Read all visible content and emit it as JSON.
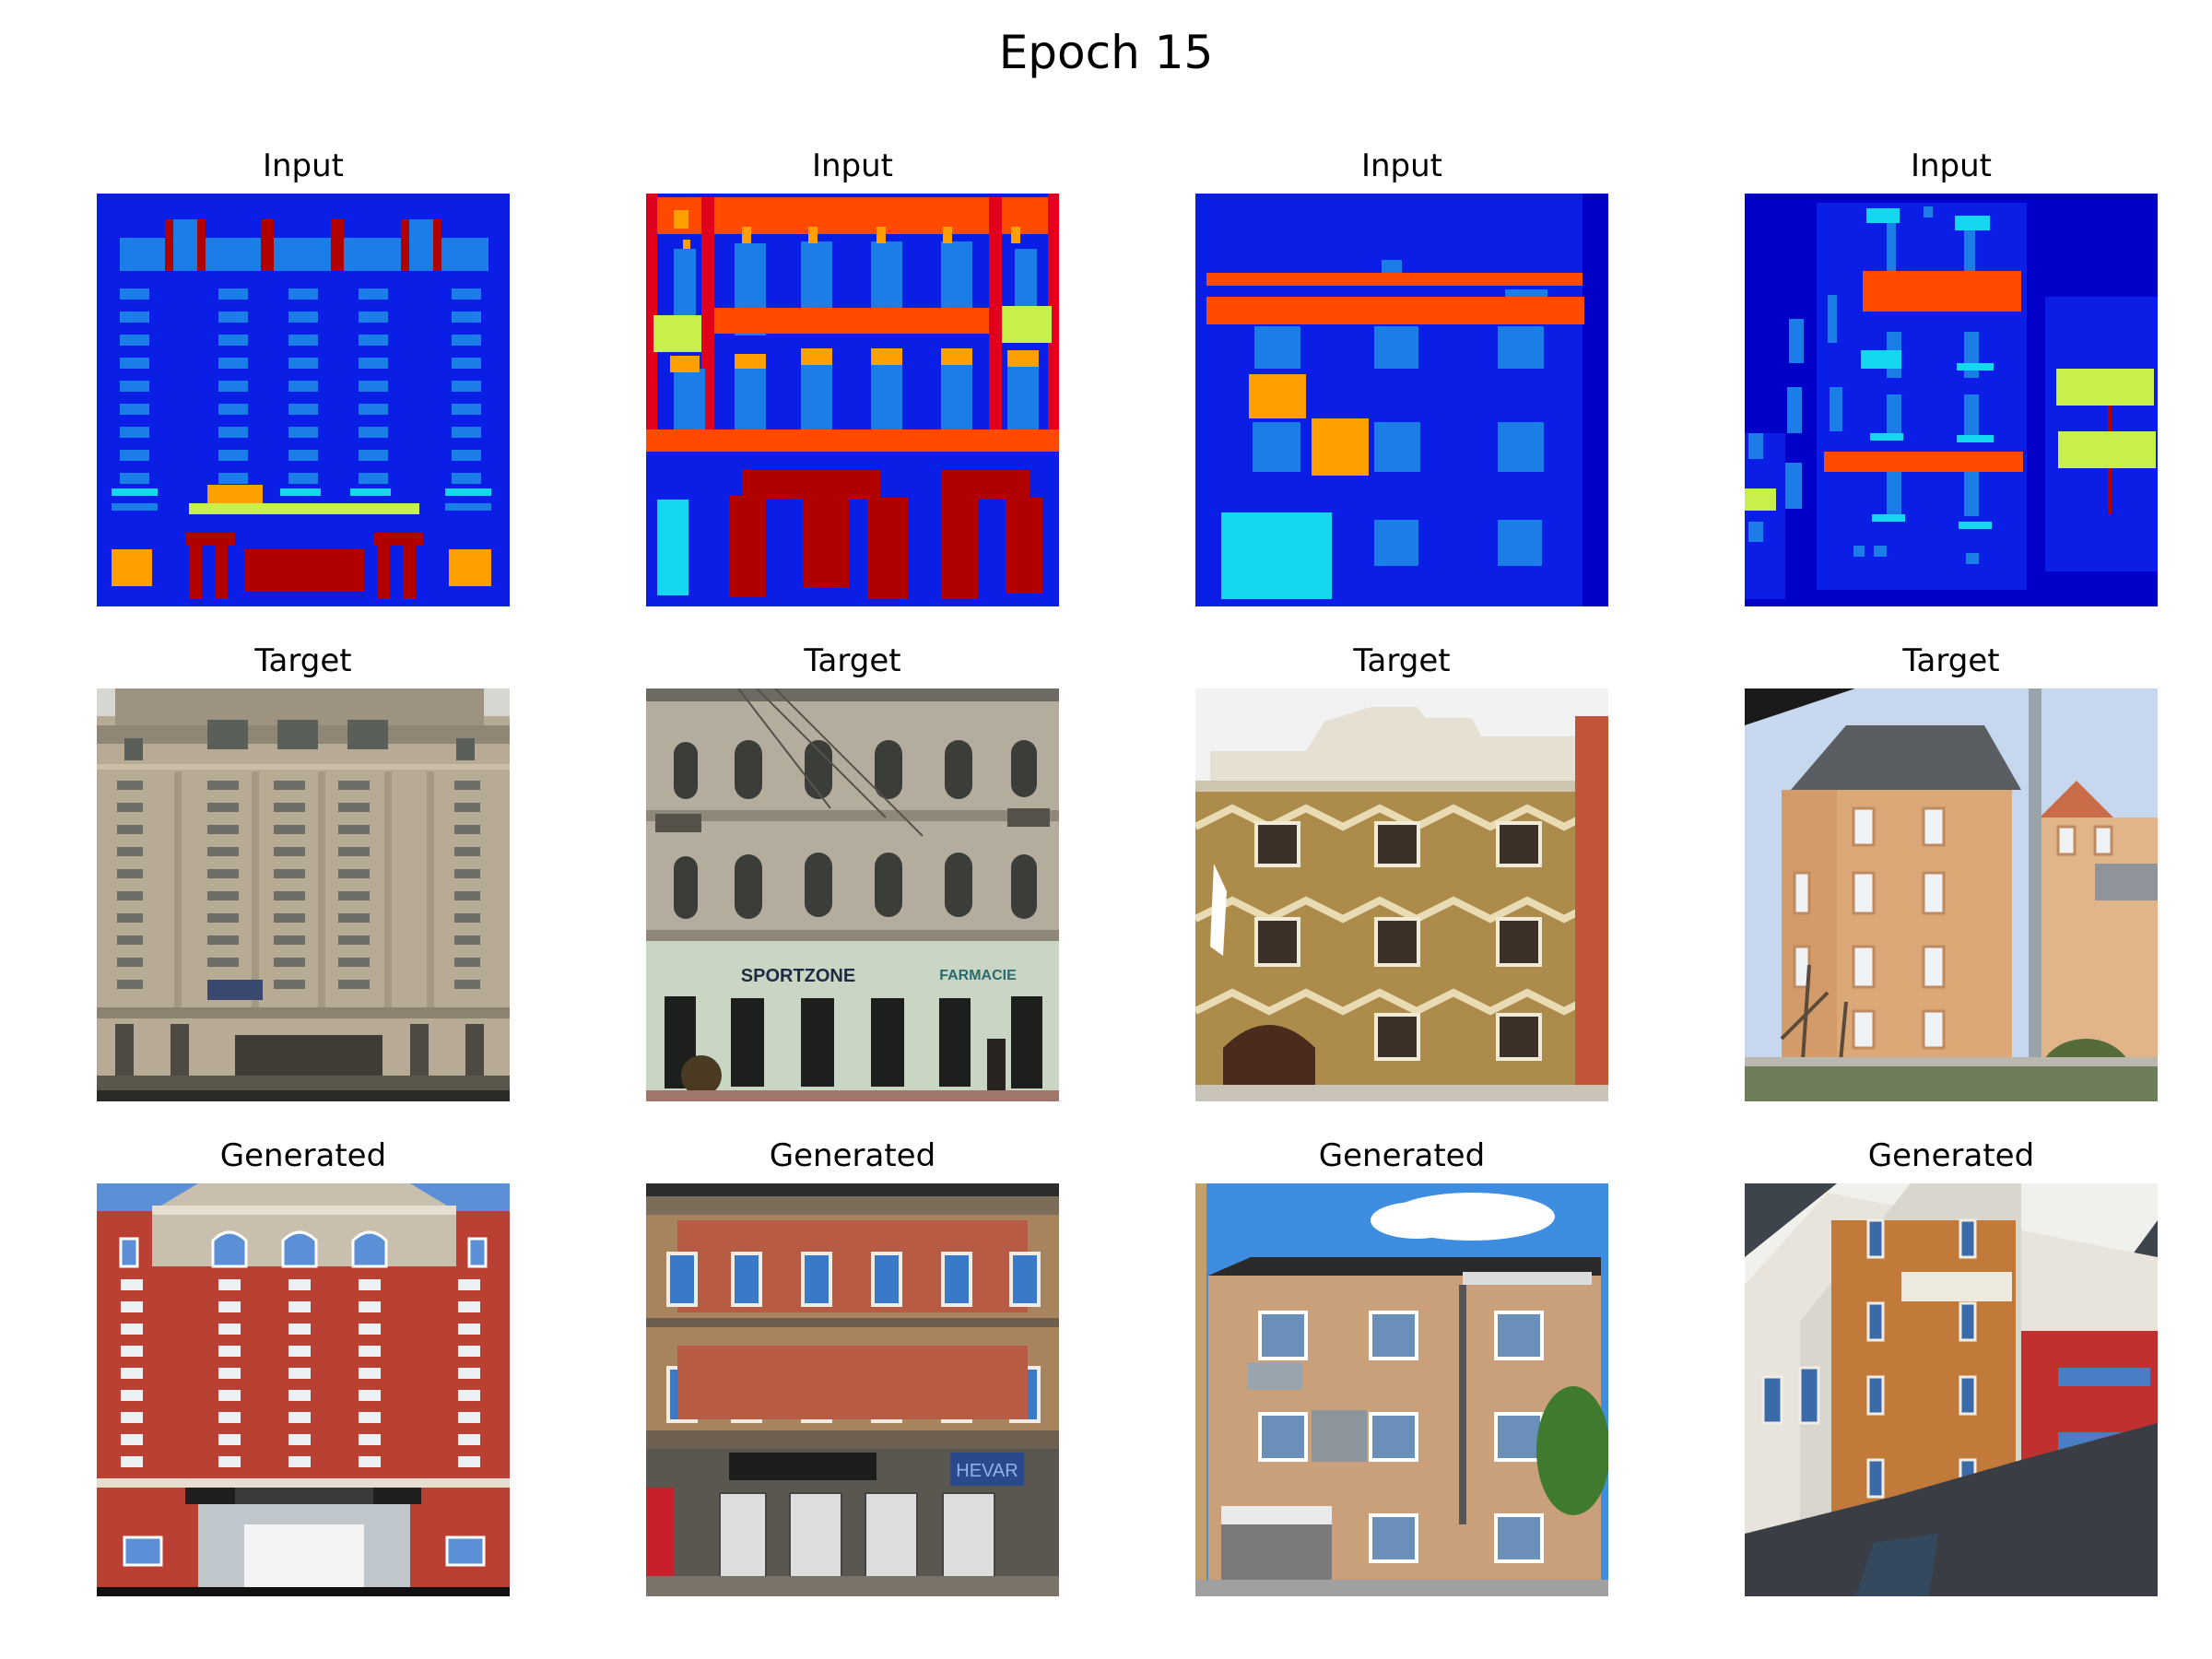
{
  "figure": {
    "title": "Epoch 15",
    "row_titles": [
      "Input",
      "Target",
      "Generated"
    ]
  },
  "colors": {
    "label_background": "#0a1ee6",
    "label_light_blue": "#1b7de8",
    "label_orange_red": "#ff4a00",
    "label_dark_red": "#b00000",
    "label_orange": "#ffa000",
    "label_yellow_green": "#c8f04a",
    "label_cyan": "#15d7f0",
    "label_dark_navy": "#0000c8"
  },
  "panels": [
    {
      "id": "input-1",
      "title": "Input",
      "image": "facade-label-map-1"
    },
    {
      "id": "input-2",
      "title": "Input",
      "image": "facade-label-map-2"
    },
    {
      "id": "input-3",
      "title": "Input",
      "image": "facade-label-map-3"
    },
    {
      "id": "input-4",
      "title": "Input",
      "image": "facade-label-map-4"
    },
    {
      "id": "target-1",
      "title": "Target",
      "image": "beige-highrise-photo"
    },
    {
      "id": "target-2",
      "title": "Target",
      "image": "arched-window-building-photo"
    },
    {
      "id": "target-3",
      "title": "Target",
      "image": "ornate-patterned-facade-photo"
    },
    {
      "id": "target-4",
      "title": "Target",
      "image": "tower-house-photo"
    },
    {
      "id": "generated-1",
      "title": "Generated",
      "image": "red-brick-highrise-render"
    },
    {
      "id": "generated-2",
      "title": "Generated",
      "image": "brick-storefront-render"
    },
    {
      "id": "generated-3",
      "title": "Generated",
      "image": "suburban-house-render"
    },
    {
      "id": "generated-4",
      "title": "Generated",
      "image": "tilted-facade-render"
    }
  ]
}
